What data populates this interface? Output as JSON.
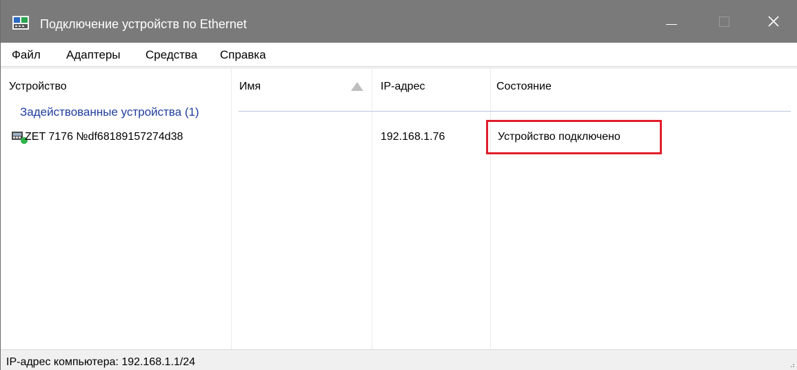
{
  "window": {
    "title": "Подключение устройств по Ethernet",
    "icon": "network-device-icon",
    "controls": [
      "minimize-icon",
      "maximize-icon",
      "close-icon"
    ]
  },
  "menu": {
    "items": [
      "Файл",
      "Адаптеры",
      "Средства",
      "Справка"
    ]
  },
  "list": {
    "columns": [
      "Устройство",
      "Имя",
      "IP-адрес",
      "Состояние"
    ],
    "sort_indicator": "sort-ascending-icon",
    "group": {
      "label": "Задействованные устройства (1)"
    },
    "rows": [
      {
        "device": "ZET 7176 №df68189157274d38",
        "name": "",
        "ip": "192.168.1.76",
        "state": "Устройство подключено",
        "icon": "ethernet-device-connected-icon"
      }
    ],
    "highlight_color": "#e01d2a"
  },
  "statusbar": {
    "text": "IP-адрес компьютера: 192.168.1.1/24"
  },
  "colors": {
    "titlebar": "#7a7a7a",
    "group_text": "#1f3d9c",
    "statusbar": "#f0f0f0"
  }
}
